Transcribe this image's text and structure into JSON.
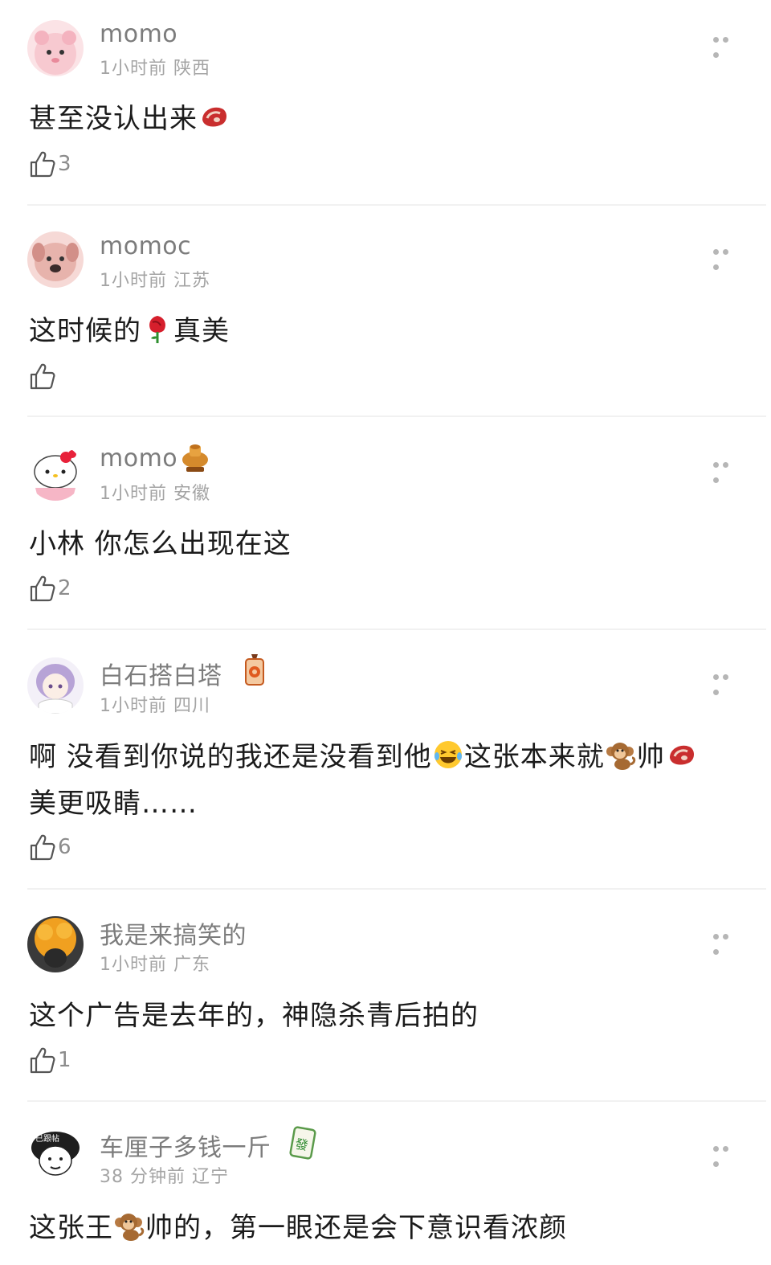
{
  "comments": [
    {
      "user": "momo",
      "time": "1小时前",
      "location": "陕西",
      "text_before": "甚至没认出来",
      "text_after": "",
      "emoji": "steak-emoji",
      "likes": "3"
    },
    {
      "user": "momoc",
      "time": "1小时前",
      "location": "江苏",
      "text_before": "这时候的",
      "text_after": "真美",
      "emoji": "rose-emoji",
      "likes": ""
    },
    {
      "user": "momo",
      "time": "1小时前",
      "location": "安徽",
      "text_before": "小林 你怎么出现在这",
      "text_after": "",
      "emoji": "",
      "likes": "2",
      "badge": "hotpot-badge"
    },
    {
      "user": "白石搭白塔",
      "time": "1小时前",
      "location": "四川",
      "line1_a": "啊 没看到你说的我还是没看到他",
      "line1_b": "这张本来就",
      "line1_c": "帅",
      "line2": "美更吸睛……",
      "emojis": [
        "laughing-crying-emoji",
        "monkey-emoji",
        "steak-emoji"
      ],
      "likes": "6",
      "badge": "amulet-badge"
    },
    {
      "user": "我是来搞笑的",
      "time": "1小时前",
      "location": "广东",
      "text_before": "这个广告是去年的，神隐杀青后拍的",
      "text_after": "",
      "emoji": "",
      "likes": "1"
    },
    {
      "user": "车厘子多钱一斤",
      "time": "38 分钟前",
      "location": "辽宁",
      "text_before": "这张王",
      "text_after": "帅的，第一眼还是会下意识看浓颜",
      "emoji": "monkey-emoji",
      "likes": "",
      "badge": "mahjong-fa-badge",
      "badge_char": "發",
      "avatar_caption": "已跟帖"
    }
  ],
  "colors": {
    "username": "#7c7c7c",
    "meta": "#a4a4a4",
    "body_text": "#1b1b1b",
    "like_count": "#8c8c8c",
    "divider": "#f1f1f1"
  },
  "icons": {
    "like": "thumbs-up-icon",
    "more": "more-dots-icon"
  }
}
